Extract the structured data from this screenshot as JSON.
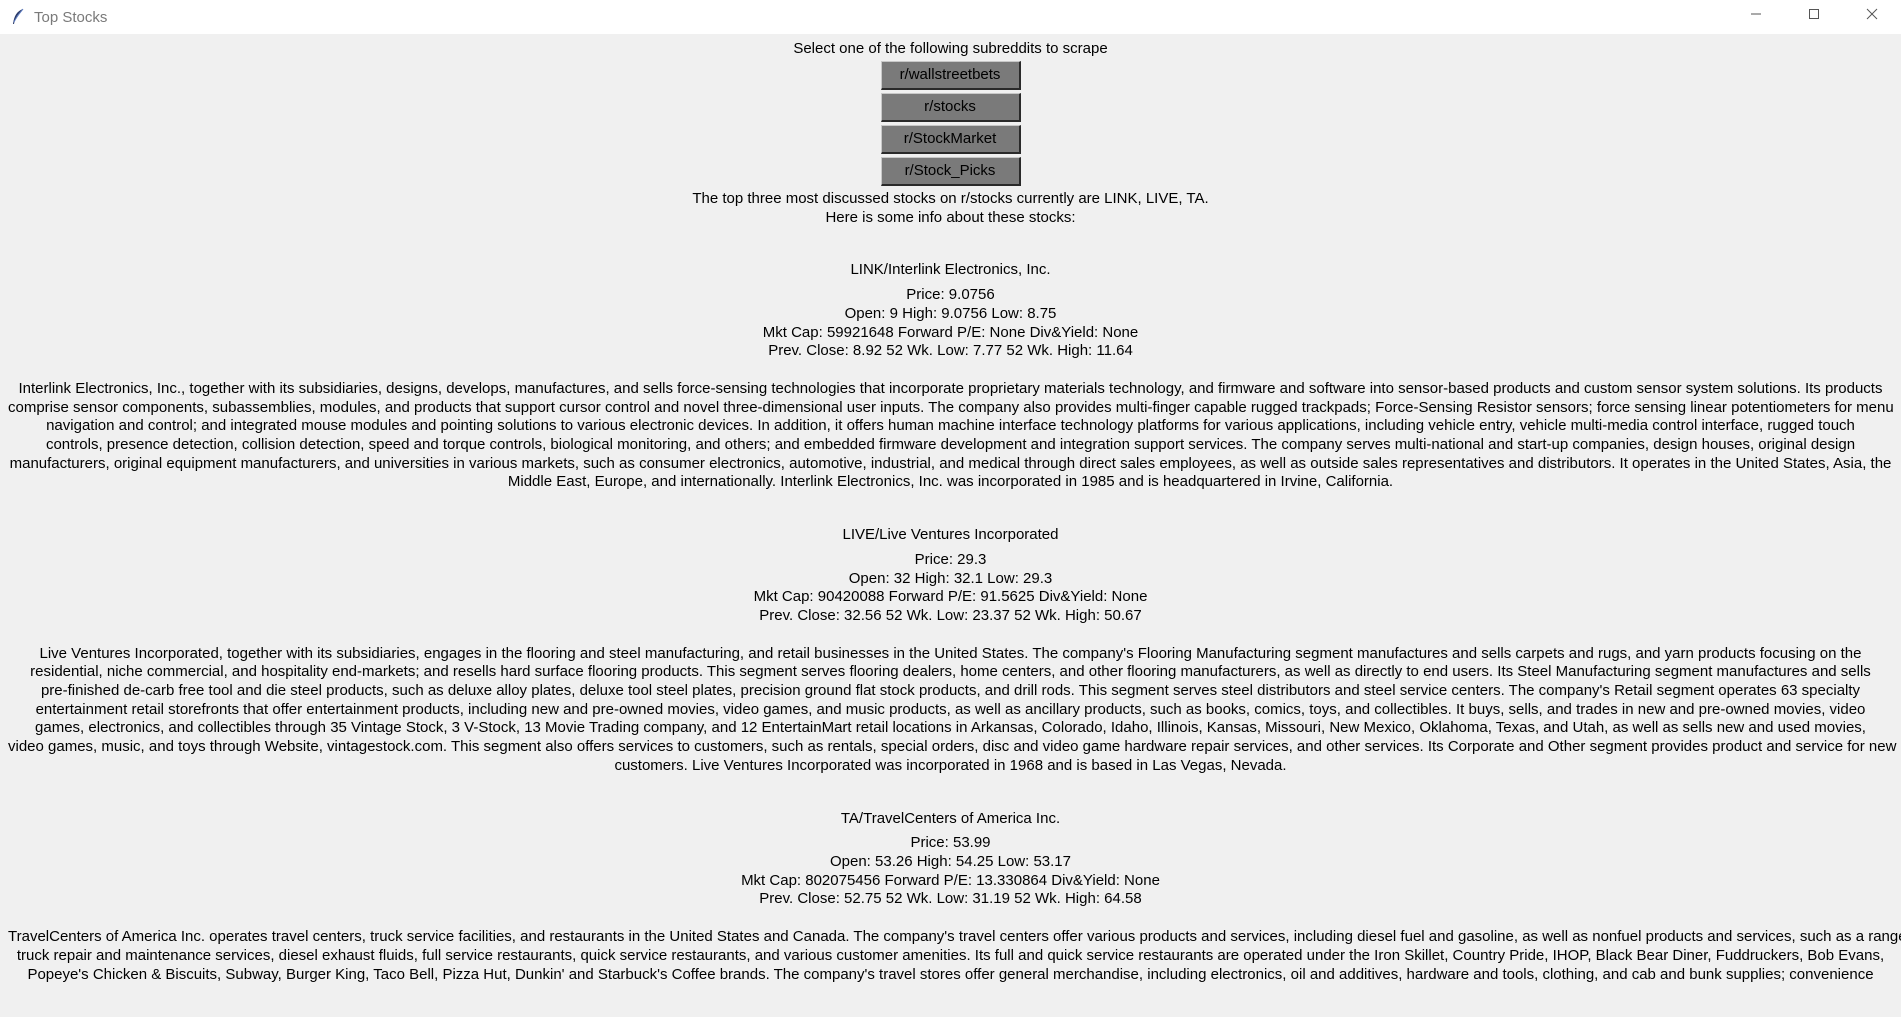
{
  "window": {
    "title": "Top Stocks"
  },
  "prompt": "Select one of the following subreddits to scrape",
  "subreddits": [
    "r/wallstreetbets",
    "r/stocks",
    "r/StockMarket",
    "r/Stock_Picks"
  ],
  "summary": {
    "line1": "The top three most discussed stocks on r/stocks currently are LINK, LIVE, TA.",
    "line2": "Here is some info about these stocks:"
  },
  "stocks": [
    {
      "name": "LINK/Interlink Electronics, Inc.",
      "price": "Price: 9.0756",
      "open_line": "Open: 9  High: 9.0756    Low: 8.75",
      "cap_line": "Mkt Cap: 59921648  Forward P/E: None  Div&Yield: None",
      "prev_line": "Prev. Close: 8.92  52 Wk. Low: 7.77  52 Wk. High: 11.64",
      "desc": [
        "Interlink Electronics, Inc., together with its subsidiaries, designs, develops, manufactures, and sells force-sensing technologies that incorporate proprietary materials technology, and firmware and software into sensor-based products and custom sensor system solutions. Its products",
        "comprise sensor components, subassemblies, modules, and products that support cursor control and novel three-dimensional user inputs. The company also provides multi-finger capable rugged trackpads; Force-Sensing Resistor sensors; force sensing linear potentiometers for menu",
        "navigation and control; and integrated mouse modules and pointing solutions to various electronic devices. In addition, it offers human machine interface technology platforms for various applications, including vehicle entry, vehicle multi-media control interface, rugged touch",
        "controls, presence detection, collision detection, speed and torque controls, biological monitoring, and others; and embedded firmware development and integration support services. The company serves multi-national and start-up companies, design houses, original design",
        "manufacturers, original equipment manufacturers, and universities in various markets, such as consumer electronics, automotive, industrial, and medical through direct sales employees, as well as outside sales representatives and distributors. It operates in the United States, Asia, the",
        "Middle East, Europe, and internationally. Interlink Electronics, Inc. was incorporated in 1985 and is headquartered in Irvine, California."
      ]
    },
    {
      "name": "LIVE/Live Ventures Incorporated",
      "price": "Price: 29.3",
      "open_line": "Open: 32  High: 32.1    Low: 29.3",
      "cap_line": "Mkt Cap: 90420088  Forward P/E: 91.5625  Div&Yield: None",
      "prev_line": "Prev. Close: 32.56  52 Wk. Low: 23.37  52 Wk. High: 50.67",
      "desc": [
        "Live Ventures Incorporated, together with its subsidiaries, engages in the flooring and steel manufacturing, and retail businesses in the United States. The company's Flooring Manufacturing segment manufactures and sells carpets and rugs, and yarn products focusing on the",
        "residential, niche commercial, and hospitality end-markets; and resells hard surface flooring products. This segment serves flooring dealers, home centers, and other flooring manufacturers, as well as directly to end users. Its Steel Manufacturing segment manufactures and sells",
        "pre-finished de-carb free tool and die steel products, such as deluxe alloy plates, deluxe tool steel plates, precision ground flat stock products, and drill rods. This segment serves steel distributors and steel service centers. The company's Retail segment operates 63 specialty",
        "entertainment retail storefronts that offer entertainment products, including new and pre-owned movies, video games, and music products, as well as ancillary products, such as books, comics, toys, and collectibles. It buys, sells, and trades in new and pre-owned movies, video",
        "games, electronics, and collectibles through 35 Vintage Stock, 3 V-Stock, 13 Movie Trading company, and 12 EntertainMart retail locations in Arkansas, Colorado, Idaho, Illinois, Kansas, Missouri, New Mexico, Oklahoma, Texas, and Utah, as well as sells new and used movies,",
        "video games, music, and toys through Website, vintagestock.com. This segment also offers services to customers, such as rentals, special orders, disc and video game hardware repair services, and other services. Its Corporate and Other segment provides product and service for new",
        "customers. Live Ventures Incorporated was incorporated in 1968 and is based in Las Vegas, Nevada."
      ]
    },
    {
      "name": "TA/TravelCenters of America Inc.",
      "price": "Price: 53.99",
      "open_line": "Open: 53.26  High: 54.25    Low: 53.17",
      "cap_line": "Mkt Cap: 802075456  Forward P/E: 13.330864  Div&Yield: None",
      "prev_line": "Prev. Close: 52.75  52 Wk. Low: 31.19  52 Wk. High: 64.58",
      "desc": [
        "TravelCenters of America Inc. operates travel centers, truck service facilities, and restaurants in the United States and Canada. The company's travel centers offer various products and services, including diesel fuel and gasoline, as well as nonfuel products and services, such as a range of",
        "truck repair and maintenance services, diesel exhaust fluids, full service restaurants, quick service restaurants, and various customer amenities. Its full and quick service restaurants are operated under the Iron Skillet, Country Pride, IHOP, Black Bear Diner, Fuddruckers, Bob Evans,",
        "Popeye's Chicken & Biscuits, Subway, Burger King, Taco Bell, Pizza Hut, Dunkin' and Starbuck's Coffee brands. The company's travel stores offer general merchandise, including electronics, oil and additives, hardware and tools, clothing, and cab and bunk supplies; convenience"
      ]
    }
  ]
}
